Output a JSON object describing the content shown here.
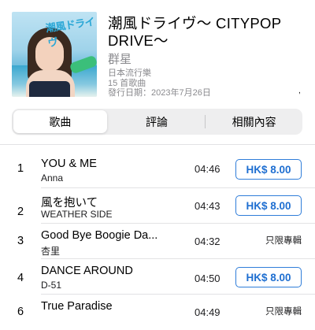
{
  "album": {
    "title": "潮風ドライヴ～ CITYPOP DRIVE～",
    "artist": "群星",
    "genre": "日本流行樂",
    "song_count": "15 首歌曲",
    "release": "發行日期：2023年7月26日",
    "cover_logo": "潮風ドライヴ",
    "edge_mark": ","
  },
  "tabs": [
    {
      "label": "歌曲",
      "active": true
    },
    {
      "label": "評論",
      "active": false
    },
    {
      "label": "相關內容",
      "active": false
    }
  ],
  "tracks": [
    {
      "num": "1",
      "title": "YOU & ME",
      "artist": "Anna",
      "duration": "04:46",
      "price": "HK$ 8.00"
    },
    {
      "num": "2",
      "title": "風を抱いて",
      "artist": "WEATHER SIDE",
      "duration": "04:43",
      "price": "HK$ 8.00"
    },
    {
      "num": "3",
      "title": "Good Bye Boogie Da...",
      "artist": "杏里",
      "duration": "04:32",
      "album_only": "只限專輯"
    },
    {
      "num": "4",
      "title": "DANCE AROUND",
      "artist": "D-51",
      "duration": "04:50",
      "price": "HK$ 8.00"
    },
    {
      "num": "6",
      "title": "True Paradise",
      "artist": "",
      "duration": "04:49",
      "album_only": "只限專輯"
    }
  ]
}
